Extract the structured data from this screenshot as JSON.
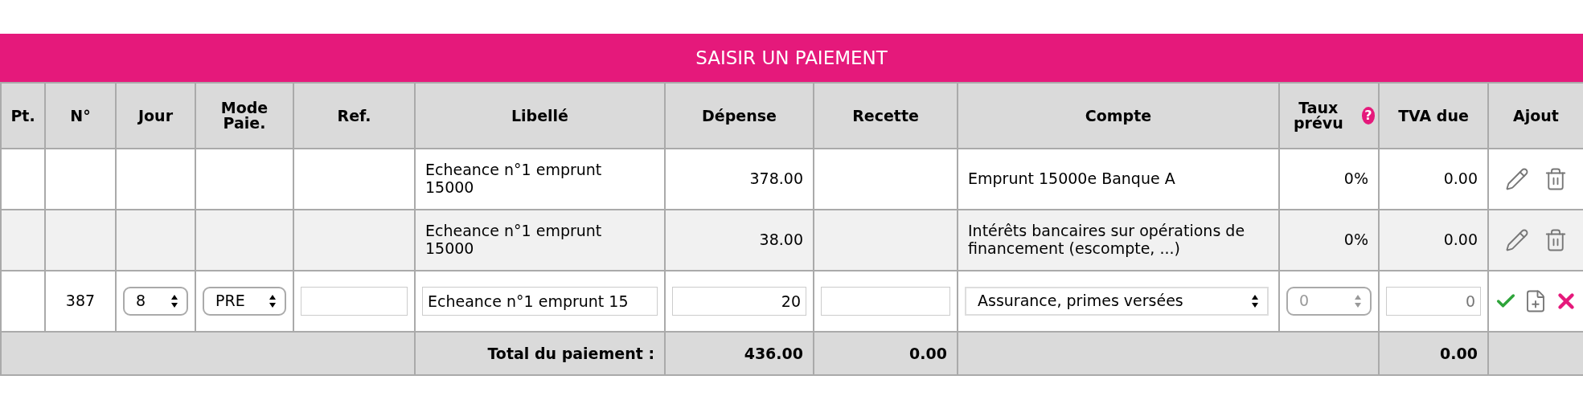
{
  "title": "SAISIR UN PAIEMENT",
  "columns": [
    {
      "label": "Pt."
    },
    {
      "label": "N°"
    },
    {
      "label": "Jour"
    },
    {
      "label": "Mode Paie."
    },
    {
      "label": "Ref."
    },
    {
      "label": "Libellé"
    },
    {
      "label": "Dépense"
    },
    {
      "label": "Recette"
    },
    {
      "label": "Compte"
    },
    {
      "label": "Taux prévu",
      "help": "?"
    },
    {
      "label": "TVA due"
    },
    {
      "label": "Ajout"
    }
  ],
  "rows": [
    {
      "libelle": "Echeance n°1 emprunt 15000",
      "depense": "378.00",
      "compte": "Emprunt 15000e Banque A",
      "taux": "0%",
      "tva": "0.00"
    },
    {
      "libelle": "Echeance n°1 emprunt 15000",
      "depense": "38.00",
      "compte": "Intérêts bancaires sur opérations de financement (escompte, ...)",
      "taux": "0%",
      "tva": "0.00"
    }
  ],
  "edit_row": {
    "numero": "387",
    "jour": {
      "value": "8",
      "disabled": false
    },
    "mode": {
      "value": "PRE",
      "disabled": false
    },
    "libelle": "Echeance n°1 emprunt 15",
    "depense": "20",
    "compte": {
      "value": "Assurance, primes versées",
      "disabled": false
    },
    "taux": {
      "value": "0",
      "disabled": true
    },
    "tva": "0"
  },
  "total": {
    "label": "Total du paiement :",
    "depense": "436.00",
    "recette": "0.00",
    "tva": "0.00"
  }
}
